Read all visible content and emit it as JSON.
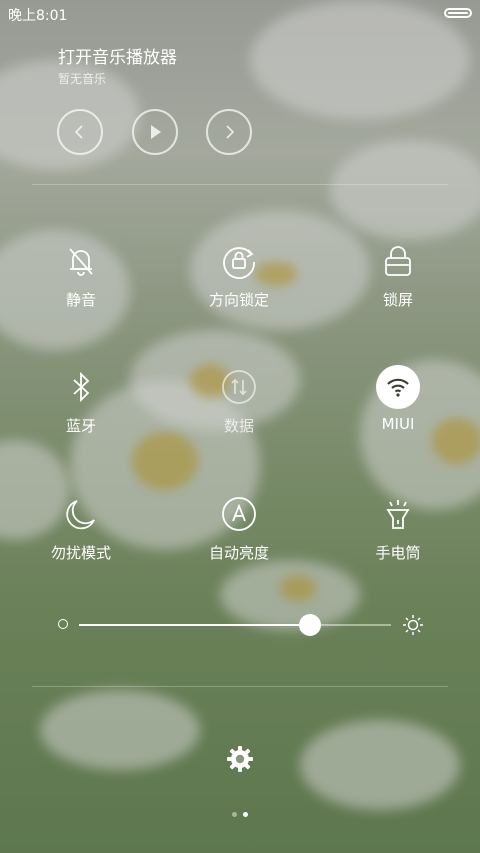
{
  "status_bar": {
    "time": "晚上8:01",
    "battery_level": 1.0
  },
  "music": {
    "title": "打开音乐播放器",
    "subtitle": "暂无音乐",
    "controls": [
      {
        "name": "previous",
        "icon": "chevron-left-icon"
      },
      {
        "name": "play",
        "icon": "play-icon"
      },
      {
        "name": "next",
        "icon": "chevron-right-icon"
      }
    ]
  },
  "toggles": [
    {
      "id": "mute",
      "label": "静音",
      "icon": "bell-off-icon",
      "active": false
    },
    {
      "id": "rotation-lock",
      "label": "方向锁定",
      "icon": "rotation-lock-icon",
      "active": false
    },
    {
      "id": "lock-screen",
      "label": "锁屏",
      "icon": "lock-icon",
      "active": false
    },
    {
      "id": "bluetooth",
      "label": "蓝牙",
      "icon": "bluetooth-icon",
      "active": false
    },
    {
      "id": "mobile-data",
      "label": "数据",
      "icon": "data-arrows-icon",
      "active": false
    },
    {
      "id": "wifi",
      "label": "MIUI",
      "icon": "wifi-icon",
      "active": true
    },
    {
      "id": "do-not-disturb",
      "label": "勿扰模式",
      "icon": "moon-icon",
      "active": false
    },
    {
      "id": "auto-brightness",
      "label": "自动亮度",
      "icon": "auto-brightness-icon",
      "active": false
    },
    {
      "id": "flashlight",
      "label": "手电筒",
      "icon": "flashlight-icon",
      "active": false
    }
  ],
  "brightness": {
    "value": 0.74,
    "min_icon": "circle-icon",
    "max_icon": "sun-icon"
  },
  "settings": {
    "icon": "gear-icon"
  },
  "pager": {
    "count": 2,
    "current": 1
  },
  "colors": {
    "accent": "#ffffff",
    "active_icon": "#3a3f36"
  }
}
